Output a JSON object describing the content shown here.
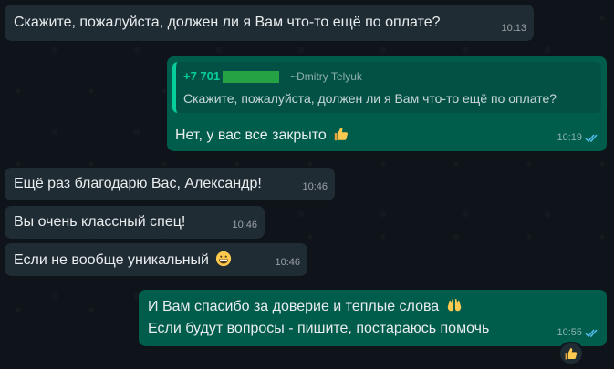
{
  "messages": [
    {
      "id": "m1",
      "direction": "incoming",
      "text": "Скажите, пожалуйста, должен ли я Вам что-то ещё по оплате?",
      "time": "10:13"
    },
    {
      "id": "m2",
      "direction": "outgoing",
      "quote": {
        "sender": "+7 701",
        "alias": "~Dmitry Telyuk",
        "text": "Скажите, пожалуйста, должен ли я Вам что-то ещё по оплате?"
      },
      "text": "Нет, у вас все закрыто",
      "emoji": "thumbs-up-emoji",
      "time": "10:19",
      "status": "read"
    },
    {
      "id": "m3",
      "direction": "incoming",
      "text": "Ещё раз благодарю Вас, Александр!",
      "time": "10:46"
    },
    {
      "id": "m4",
      "direction": "incoming",
      "text": "Вы очень классный спец!",
      "time": "10:46"
    },
    {
      "id": "m5",
      "direction": "incoming",
      "text": "Если не вообще уникальный",
      "emoji": "grinning-face-emoji",
      "time": "10:46"
    },
    {
      "id": "m6",
      "direction": "outgoing",
      "line1": "И Вам спасибо за доверие и теплые слова",
      "line1_emoji": "raised-hands-emoji",
      "line2": "Если будут вопросы - пишите, постараюсь помочь",
      "time": "10:55",
      "status": "read",
      "reaction": "thumbs-up-emoji"
    }
  ],
  "colors": {
    "incoming_bubble": "#202c33",
    "outgoing_bubble": "#005c4b",
    "quote_accent": "#06cf9c",
    "read_ticks": "#53bdeb",
    "background": "#0e1419"
  }
}
